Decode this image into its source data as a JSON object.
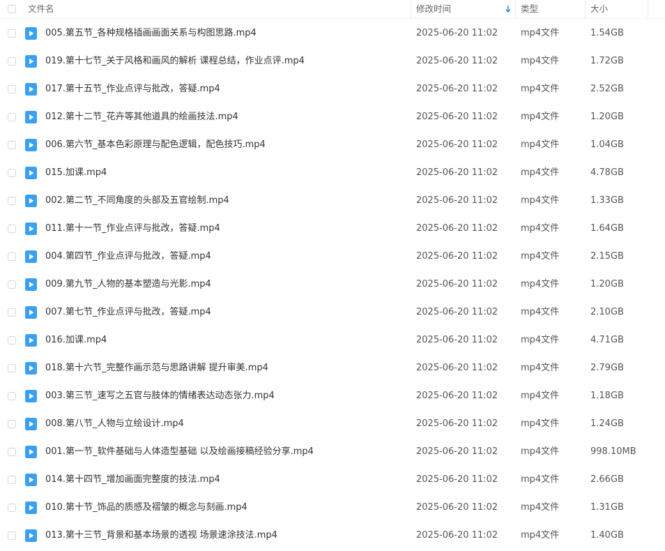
{
  "header": {
    "name": "文件名",
    "time": "修改时间",
    "type": "类型",
    "size": "大小"
  },
  "colors": {
    "icon_blue": "#3aa0f2",
    "sort_blue": "#2c8fe8"
  },
  "files": [
    {
      "name": "005.第五节_各种规格插画画面关系与构图思路.mp4",
      "time": "2025-06-20 11:02",
      "type": "mp4文件",
      "size": "1.54GB"
    },
    {
      "name": "019.第十七节_关于风格和画风的解析 课程总结，作业点评.mp4",
      "time": "2025-06-20 11:02",
      "type": "mp4文件",
      "size": "1.72GB"
    },
    {
      "name": "017.第十五节_作业点评与批改，答疑.mp4",
      "time": "2025-06-20 11:02",
      "type": "mp4文件",
      "size": "2.52GB"
    },
    {
      "name": "012.第十二节_花卉等其他道具的绘画技法.mp4",
      "time": "2025-06-20 11:02",
      "type": "mp4文件",
      "size": "1.20GB"
    },
    {
      "name": "006.第六节_基本色彩原理与配色逻辑，配色技巧.mp4",
      "time": "2025-06-20 11:02",
      "type": "mp4文件",
      "size": "1.04GB"
    },
    {
      "name": "015.加课.mp4",
      "time": "2025-06-20 11:02",
      "type": "mp4文件",
      "size": "4.78GB"
    },
    {
      "name": "002.第二节_不同角度的头部及五官绘制.mp4",
      "time": "2025-06-20 11:02",
      "type": "mp4文件",
      "size": "1.33GB"
    },
    {
      "name": "011.第十一节_作业点评与批改，答疑.mp4",
      "time": "2025-06-20 11:02",
      "type": "mp4文件",
      "size": "1.64GB"
    },
    {
      "name": "004.第四节_作业点评与批改，答疑.mp4",
      "time": "2025-06-20 11:02",
      "type": "mp4文件",
      "size": "2.15GB"
    },
    {
      "name": "009.第九节_人物的基本塑造与光影.mp4",
      "time": "2025-06-20 11:02",
      "type": "mp4文件",
      "size": "1.20GB"
    },
    {
      "name": "007.第七节_作业点评与批改，答疑.mp4",
      "time": "2025-06-20 11:02",
      "type": "mp4文件",
      "size": "2.10GB"
    },
    {
      "name": "016.加课.mp4",
      "time": "2025-06-20 11:02",
      "type": "mp4文件",
      "size": "4.71GB"
    },
    {
      "name": "018.第十六节_完整作画示范与思路讲解 提升审美.mp4",
      "time": "2025-06-20 11:02",
      "type": "mp4文件",
      "size": "2.79GB"
    },
    {
      "name": "003.第三节_速写之五官与肢体的情绪表达动态张力.mp4",
      "time": "2025-06-20 11:02",
      "type": "mp4文件",
      "size": "1.18GB"
    },
    {
      "name": "008.第八节_人物与立绘设计.mp4",
      "time": "2025-06-20 11:02",
      "type": "mp4文件",
      "size": "1.24GB"
    },
    {
      "name": "001.第一节_软件基础与人体造型基础 以及绘画接稿经验分享.mp4",
      "time": "2025-06-20 11:02",
      "type": "mp4文件",
      "size": "998.10MB"
    },
    {
      "name": "014.第十四节_增加画面完整度的技法.mp4",
      "time": "2025-06-20 11:02",
      "type": "mp4文件",
      "size": "2.66GB"
    },
    {
      "name": "010.第十节_饰品的质感及褶皱的概念与刻画.mp4",
      "time": "2025-06-20 11:02",
      "type": "mp4文件",
      "size": "1.31GB"
    },
    {
      "name": "013.第十三节_背景和基本场景的透视 场景速涂技法.mp4",
      "time": "2025-06-20 11:02",
      "type": "mp4文件",
      "size": "1.40GB"
    }
  ]
}
